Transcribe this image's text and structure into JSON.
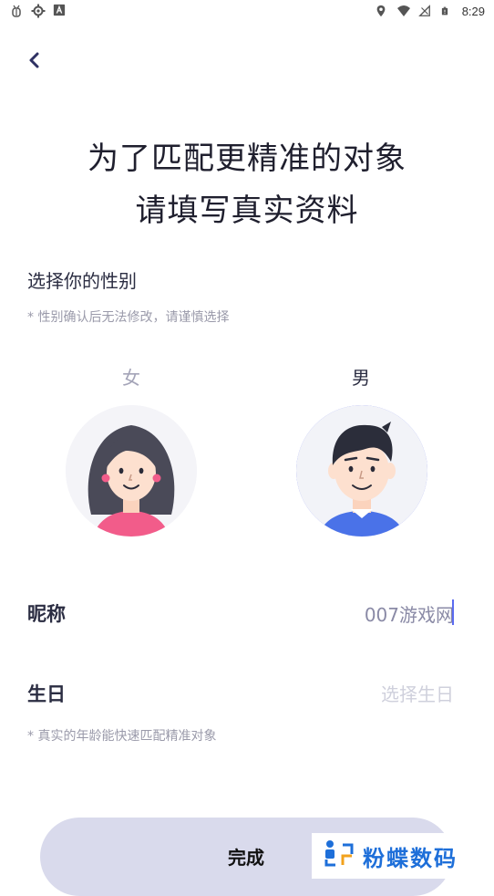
{
  "status_bar": {
    "time": "8:29",
    "left_icons": [
      "bug-icon",
      "settings-gear-icon",
      "text-a-icon"
    ],
    "right_icons": [
      "location-icon",
      "wifi-icon",
      "no-signal-icon",
      "battery-icon"
    ]
  },
  "header": {
    "back_icon": "chevron-left-icon",
    "headline_line1": "为了匹配更精准的对象",
    "headline_line2": "请填写真实资料"
  },
  "gender": {
    "title": "选择你的性别",
    "note": "* 性别确认后无法修改，请谨慎选择",
    "options": [
      {
        "label": "女",
        "selected": false
      },
      {
        "label": "男",
        "selected": true
      }
    ]
  },
  "form": {
    "nickname_label": "昵称",
    "nickname_value": "007游戏网",
    "birthday_label": "生日",
    "birthday_placeholder": "选择生日",
    "age_note": "* 真实的年龄能快速匹配精准对象"
  },
  "actions": {
    "done_label": "完成"
  },
  "watermark": {
    "text": "粉蝶数码"
  },
  "colors": {
    "accent": "#5b6bf0",
    "button_bg": "#d9daec",
    "muted_text": "#9a9aaa",
    "watermark_blue": "#1e6fd9"
  }
}
